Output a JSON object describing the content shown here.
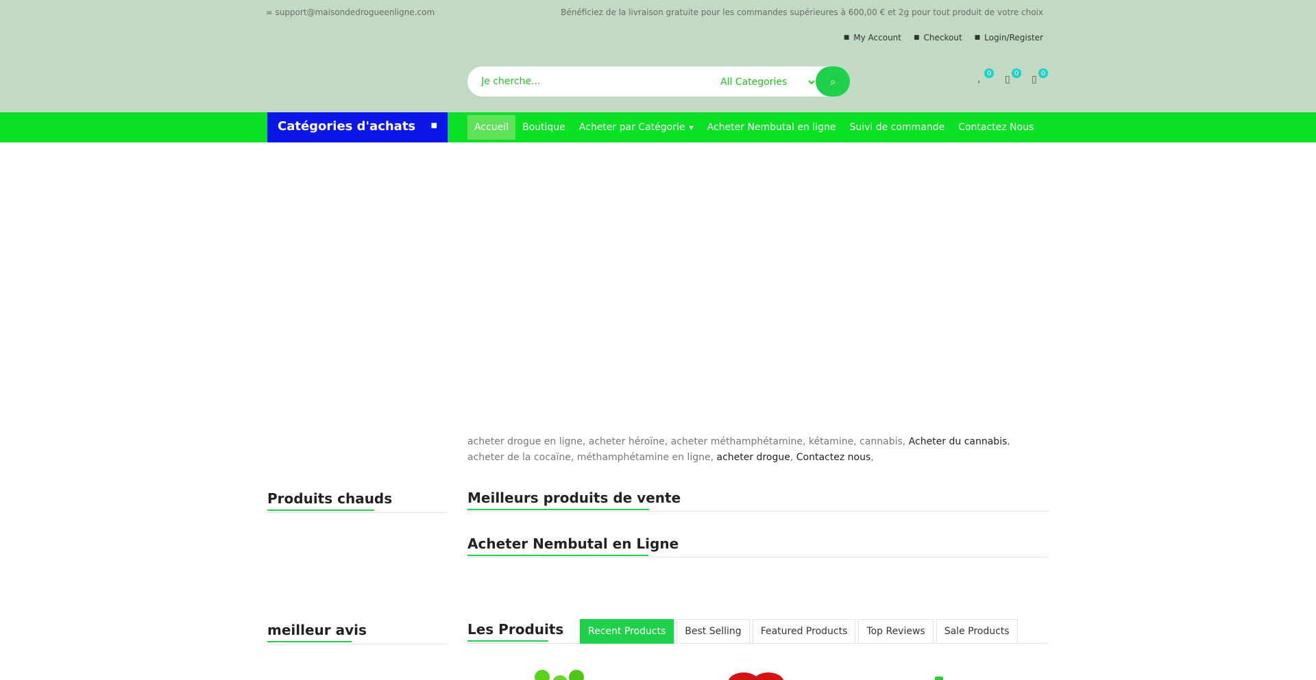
{
  "topbar": {
    "email": "support@maisondedrogueenligne.com",
    "promo": "Bénéficiez de la livraison gratuite pour les commandes supérieures à 600,00 € et 2g pour tout produit de votre choix",
    "links": [
      "My Account",
      "Checkout",
      "Login/Register"
    ]
  },
  "search": {
    "placeholder": "Je cherche...",
    "category_selected": "All Categories"
  },
  "header_icons": [
    {
      "name": "compare-icon",
      "count": "0"
    },
    {
      "name": "wishlist-icon",
      "count": "0"
    },
    {
      "name": "cart-icon",
      "count": "0"
    }
  ],
  "nav": {
    "categories_label": "Catégories d'achats",
    "items": [
      "Accueil",
      "Boutique",
      "Acheter par Catégorie",
      "Acheter Nembutal en ligne",
      "Suivi de commande",
      "Contactez Nous"
    ]
  },
  "intro": {
    "part1": "acheter drogue en ligne, acheter héroïne, acheter méthamphétamine, kétamine, cannabis,",
    "link1": "Acheter du cannabis",
    "part2": ", acheter de la cocaïne, méthamphétamine en ligne,",
    "link2": "acheter drogue",
    "sep": ",",
    "link3": "Contactez nous",
    "end": ","
  },
  "sections": {
    "hot_products": "Produits chauds",
    "best_sellers": "Meilleurs produits de vente",
    "nembutal": "Acheter Nembutal en Ligne",
    "best_reviews": "meilleur avis",
    "products": "Les Produits"
  },
  "tabs": [
    "Recent Products",
    "Best Selling",
    "Featured Products",
    "Top Reviews",
    "Sale Products"
  ],
  "colors": {
    "header_bg": "#c2d9c3",
    "nav_bg": "#0ae125",
    "categories_bg": "#0b17e8",
    "accent": "#1ed04a",
    "badge": "#1ad1c8"
  }
}
